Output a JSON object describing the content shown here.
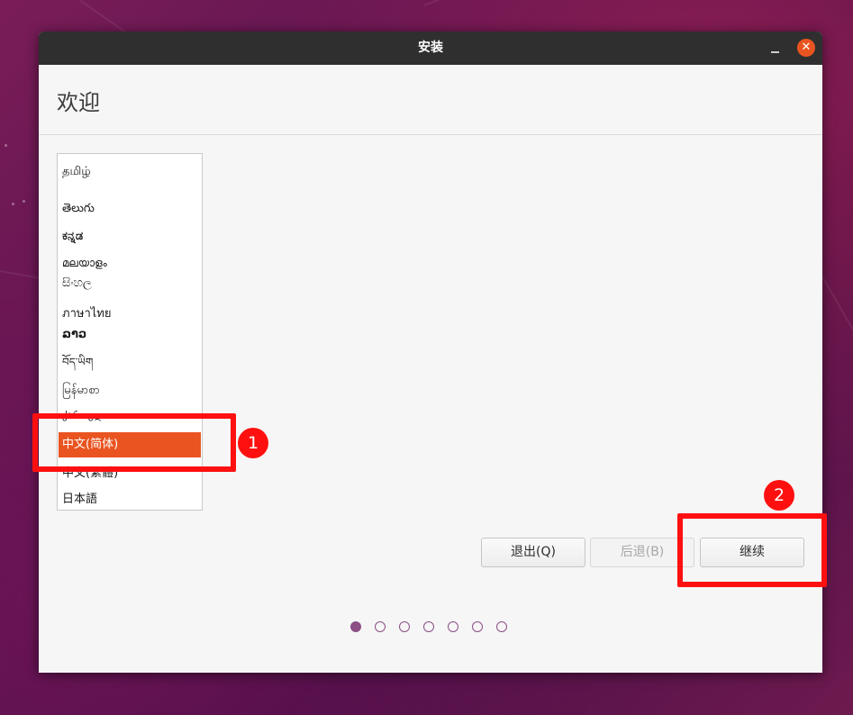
{
  "window": {
    "title": "安装",
    "close_glyph": "✕",
    "minimize_glyph": ""
  },
  "page": {
    "title": "欢迎"
  },
  "languages": [
    "தமிழ்",
    "తెలుగు",
    "ಕನ್ನಡ",
    "മലയാളം",
    "සිංහල",
    "ภาษาไทย",
    "ລາວ",
    "བོད་ཡིག",
    "မြန်မာစာ",
    "ქართული",
    "中文(简体)",
    "中文(繁體)",
    "日本語"
  ],
  "selected_language": "中文(简体)",
  "buttons": {
    "quit": "退出(Q)",
    "back": "后退(B)",
    "continue": "继续"
  },
  "pager": {
    "total": 7,
    "current": 1
  },
  "annotations": {
    "badge1": "1",
    "badge2": "2"
  },
  "colors": {
    "accent": "#e95420",
    "annotation": "#ff1010",
    "pager": "#8c4f86"
  }
}
